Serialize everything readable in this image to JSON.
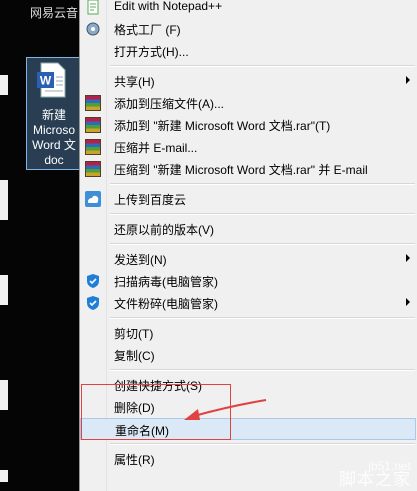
{
  "desktop": {
    "top_label": "网易云音",
    "file_name_lines": [
      "新建",
      "Microso",
      "Word 文",
      "doc"
    ]
  },
  "menu": {
    "items": [
      {
        "label": "Edit with Notepad++",
        "icon": "notepad-plus-icon"
      },
      {
        "label": "格式工厂 (F)",
        "icon": "format-factory-icon"
      },
      {
        "label": "打开方式(H)..."
      },
      {
        "label": "共享(H)",
        "submenu": true
      },
      {
        "label": "添加到压缩文件(A)...",
        "icon": "winrar-icon"
      },
      {
        "label": "添加到 \"新建 Microsoft Word 文档.rar\"(T)",
        "icon": "winrar-icon"
      },
      {
        "label": "压缩并 E-mail...",
        "icon": "winrar-icon"
      },
      {
        "label": "压缩到 \"新建 Microsoft Word 文档.rar\" 并 E-mail",
        "icon": "winrar-icon"
      },
      {
        "label": "上传到百度云",
        "icon": "baidu-cloud-icon"
      },
      {
        "label": "还原以前的版本(V)"
      },
      {
        "label": "发送到(N)",
        "submenu": true
      },
      {
        "label": "扫描病毒(电脑管家)",
        "icon": "pc-manager-icon"
      },
      {
        "label": "文件粉碎(电脑管家)",
        "icon": "pc-manager-icon",
        "submenu": true
      },
      {
        "label": "剪切(T)"
      },
      {
        "label": "复制(C)"
      },
      {
        "label": "创建快捷方式(S)"
      },
      {
        "label": "删除(D)"
      },
      {
        "label": "重命名(M)",
        "highlighted": true
      },
      {
        "label": "属性(R)"
      }
    ]
  },
  "watermark": {
    "url": "jb51.net",
    "name": "脚本之家"
  },
  "colors": {
    "annotation": "#e04141",
    "highlight": "#dbe8f6"
  }
}
